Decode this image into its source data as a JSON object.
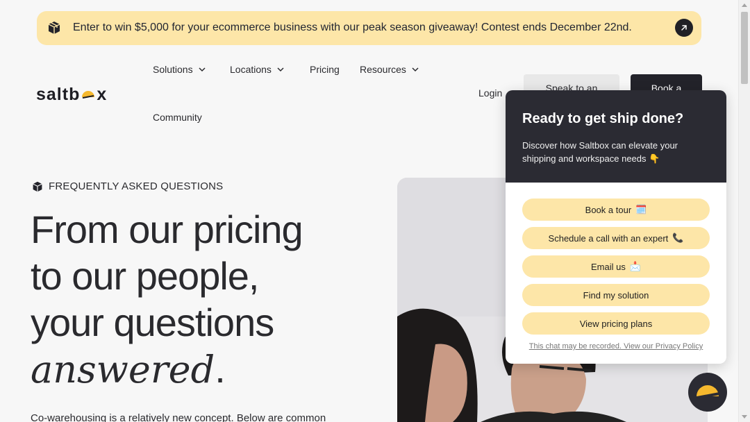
{
  "banner": {
    "text": "Enter to win $5,000 for your ecommerce business with our peak season giveaway! Contest ends December 22nd.",
    "icon": "box-icon",
    "action_icon": "arrow-up-right-icon"
  },
  "header": {
    "logo_text_before": "saltb",
    "logo_text_after": "x",
    "nav": [
      {
        "label": "Solutions",
        "has_dropdown": true
      },
      {
        "label": "Locations",
        "has_dropdown": true
      },
      {
        "label": "Pricing",
        "has_dropdown": false
      },
      {
        "label": "Resources",
        "has_dropdown": true
      },
      {
        "label": "Community",
        "has_dropdown": false
      }
    ],
    "login": "Login",
    "speak_button": "Speak to an",
    "book_button": "Book a"
  },
  "hero": {
    "eyebrow": "FREQUENTLY ASKED QUESTIONS",
    "headline_line1": "From our pricing",
    "headline_line2": "to our people,",
    "headline_line3": "your questions",
    "headline_emphasis": "answered",
    "headline_period": ".",
    "intro": "Co-warehousing is a relatively new concept. Below are common"
  },
  "chat": {
    "title": "Ready to get ship done?",
    "subtitle": "Discover how Saltbox can elevate your shipping and workspace needs 👇",
    "options": [
      {
        "label": "Book a tour",
        "emoji": "🗓️"
      },
      {
        "label": "Schedule a call with an expert",
        "emoji": "📞"
      },
      {
        "label": "Email us",
        "emoji": "📩"
      },
      {
        "label": "Find my solution",
        "emoji": ""
      },
      {
        "label": "View pricing plans",
        "emoji": ""
      }
    ],
    "footer": "This chat may be recorded. View our Privacy Policy"
  },
  "colors": {
    "accent_yellow": "#fde6a8",
    "dark": "#2b2b33",
    "brand_sun": "#f5b82e",
    "background": "#f7f7f7"
  }
}
